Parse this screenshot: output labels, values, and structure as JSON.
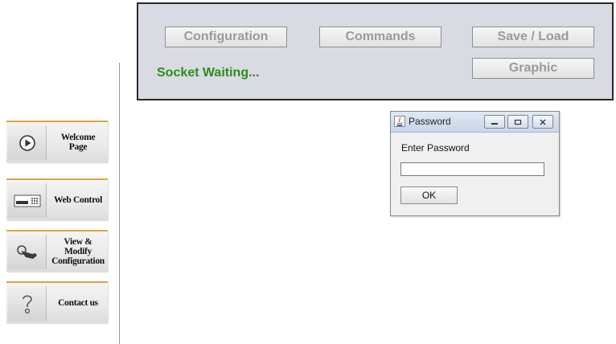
{
  "sidebar": {
    "items": [
      {
        "label": "Welcome Page",
        "icon": "play-icon"
      },
      {
        "label": "Web Control",
        "icon": "device-icon"
      },
      {
        "label": "View & Modify\nConfiguration",
        "icon": "pointer-hand-icon"
      },
      {
        "label": "Contact us",
        "icon": "question-icon"
      }
    ]
  },
  "panel": {
    "buttons": {
      "configuration": "Configuration",
      "commands": "Commands",
      "save_load": "Save / Load",
      "graphic": "Graphic"
    },
    "status": "Socket Waiting...",
    "status_color": "#2e8b1e"
  },
  "dialog": {
    "title": "Password",
    "prompt": "Enter Password",
    "password_value": "",
    "ok_label": "OK",
    "title_icon": "java-icon"
  },
  "colors": {
    "accent": "#e0a340",
    "panel_bg": "#d8dbe2",
    "button_text_disabled": "#9a9a9a"
  }
}
